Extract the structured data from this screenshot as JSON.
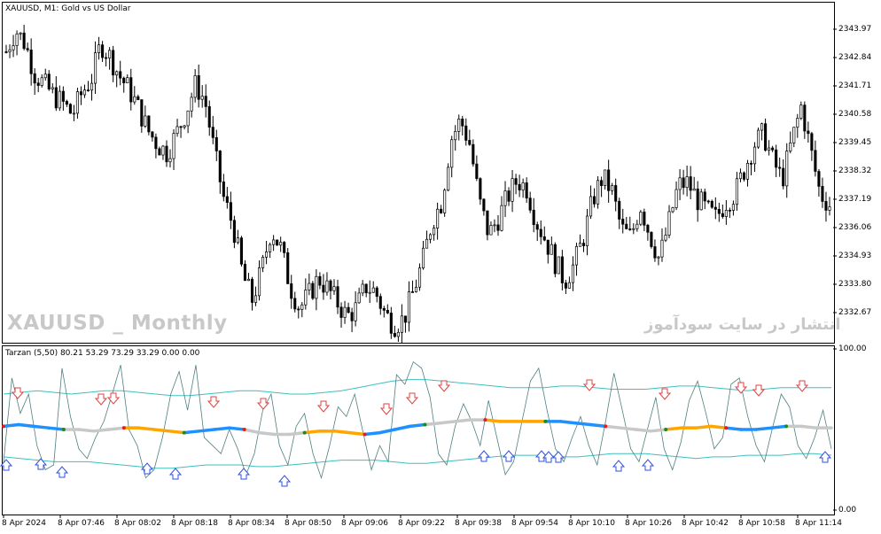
{
  "main_title": "XAUUSD, M1:  Gold vs US Dollar",
  "indicator_title": "Tarzan (5,50) 80.21 53.29 73.29 33.29 0.00 0.00",
  "price_axis": [
    "2343.97",
    "2342.84",
    "2341.71",
    "2340.58",
    "2339.45",
    "2338.32",
    "2337.19",
    "2336.06",
    "2334.93",
    "2333.80",
    "2332.67"
  ],
  "indicator_axis": [
    "100.00",
    "0.00"
  ],
  "time_axis": [
    "8 Apr 2024",
    "8 Apr 07:46",
    "8 Apr 08:02",
    "8 Apr 08:18",
    "8 Apr 08:34",
    "8 Apr 08:50",
    "8 Apr 09:06",
    "8 Apr 09:22",
    "8 Apr 09:38",
    "8 Apr 09:54",
    "8 Apr 10:10",
    "8 Apr 10:26",
    "8 Apr 10:42",
    "8 Apr 10:58",
    "8 Apr 11:14"
  ],
  "watermark_left": "XAUUSD _ Monthly",
  "watermark_right": "انتشار در سایت سودآموز",
  "colors": {
    "candle": "#000000",
    "band": "#3fbfbf",
    "oscillator": "#4f7f7f",
    "arrow_down": "#e04040",
    "arrow_up": "#3050e0",
    "mid_grey": "#c8c8c8",
    "mid_blue": "#1e90ff",
    "mid_orange": "#ffa500",
    "mid_green": "#1a8a1a",
    "mid_red": "#e02020"
  },
  "chart_data": {
    "type": "candlestick",
    "symbol": "XAUUSD",
    "timeframe": "M1",
    "ylim": [
      2332.2,
      2344.6
    ],
    "close_path": [
      2342.8,
      2343.6,
      2343.1,
      2342.0,
      2341.6,
      2341.2,
      2340.9,
      2340.5,
      2341.3,
      2341.8,
      2343.1,
      2342.6,
      2341.9,
      2341.4,
      2340.7,
      2339.9,
      2339.4,
      2339.1,
      2339.8,
      2340.6,
      2341.6,
      2341.0,
      2339.1,
      2337.4,
      2336.4,
      2334.6,
      2333.7,
      2334.8,
      2336.3,
      2335.6,
      2334.2,
      2333.4,
      2333.9,
      2334.5,
      2334.1,
      2333.6,
      2333.1,
      2333.4,
      2334.2,
      2334.0,
      2333.2,
      2332.8,
      2333.0,
      2334.0,
      2335.1,
      2336.6,
      2337.3,
      2339.6,
      2340.3,
      2339.4,
      2337.3,
      2336.1,
      2336.7,
      2337.5,
      2338.1,
      2337.8,
      2336.6,
      2335.9,
      2335.1,
      2334.4,
      2335.0,
      2336.0,
      2337.4,
      2338.2,
      2337.7,
      2336.3,
      2336.0,
      2337.2,
      2336.1,
      2335.2,
      2336.5,
      2337.9,
      2338.0,
      2337.4,
      2337.0,
      2336.7,
      2337.3,
      2337.6,
      2338.5,
      2339.4,
      2339.8,
      2338.8,
      2338.1,
      2339.5,
      2340.8,
      2339.2,
      2337.6,
      2337.2
    ]
  },
  "indicator_data": {
    "name": "Tarzan",
    "params": "(5,50)",
    "levels": [
      80.21,
      53.29,
      73.29,
      33.29,
      0.0,
      0.0
    ],
    "ylim": [
      0,
      100
    ],
    "oscillator": [
      30,
      82,
      60,
      72,
      40,
      25,
      28,
      88,
      58,
      38,
      32,
      45,
      55,
      72,
      90,
      50,
      40,
      20,
      25,
      45,
      72,
      86,
      62,
      90,
      45,
      40,
      35,
      50,
      38,
      22,
      35,
      62,
      72,
      40,
      28,
      52,
      60,
      35,
      20,
      40,
      64,
      58,
      72,
      48,
      25,
      40,
      30,
      84,
      78,
      92,
      88,
      70,
      35,
      28,
      52,
      66,
      55,
      40,
      68,
      45,
      22,
      30,
      55,
      80,
      88,
      62,
      38,
      30,
      45,
      58,
      40,
      28,
      55,
      85,
      62,
      38,
      30,
      50,
      70,
      38,
      25,
      42,
      68,
      80,
      60,
      38,
      45,
      78,
      82,
      58,
      40,
      30,
      52,
      72,
      64,
      40,
      32,
      45,
      62,
      38
    ],
    "mid_line": [
      52,
      53,
      52,
      51,
      50,
      50,
      49,
      50,
      51,
      51,
      50,
      49,
      48,
      49,
      50,
      51,
      50,
      48,
      47,
      47,
      48,
      49,
      49,
      48,
      47,
      48,
      50,
      52,
      53,
      54,
      55,
      56,
      56,
      55,
      55,
      55,
      55,
      55,
      54,
      53,
      52,
      51,
      50,
      49,
      50,
      51,
      51,
      52,
      51,
      50,
      50,
      51,
      52,
      52,
      51,
      51
    ],
    "upper_band": [
      72,
      73,
      74,
      73,
      72,
      73,
      74,
      74,
      73,
      72,
      71,
      71,
      72,
      73,
      74,
      74,
      73,
      72,
      72,
      73,
      74,
      76,
      78,
      80,
      81,
      81,
      80,
      79,
      78,
      77,
      76,
      76,
      76,
      77,
      77,
      76,
      75,
      75,
      75,
      76,
      77,
      77,
      76,
      75,
      74,
      75,
      76,
      76,
      76,
      76
    ],
    "lower_band": [
      33,
      32,
      31,
      30,
      30,
      30,
      29,
      28,
      27,
      26,
      26,
      27,
      28,
      28,
      28,
      27,
      27,
      28,
      29,
      30,
      31,
      31,
      31,
      30,
      29,
      29,
      30,
      31,
      32,
      33,
      34,
      34,
      34,
      33,
      33,
      34,
      35,
      35,
      35,
      34,
      33,
      32,
      33,
      33,
      34,
      34,
      34,
      35,
      35,
      34
    ]
  }
}
